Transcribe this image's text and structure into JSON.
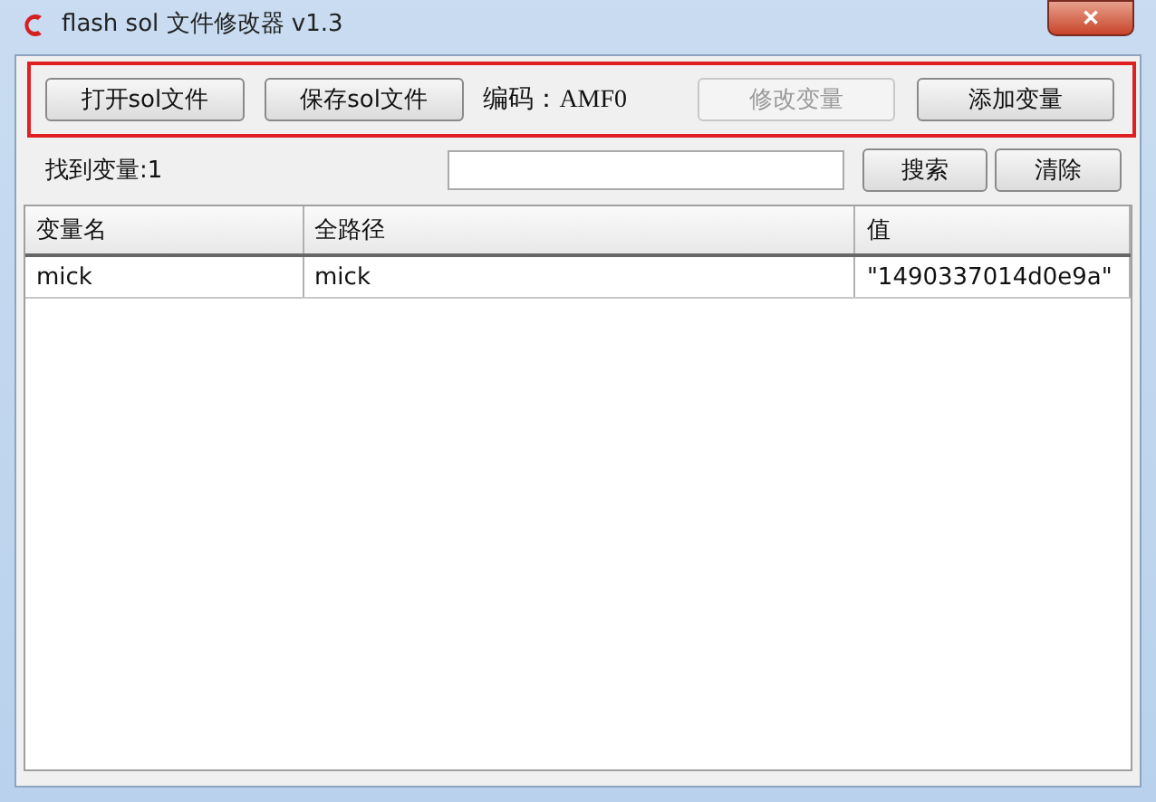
{
  "window": {
    "title": "flash sol 文件修改器 v1.3",
    "close": "✕"
  },
  "toolbar": {
    "buttons": [
      {
        "label": "打开sol文件",
        "disabled": false
      },
      {
        "label": "保存sol文件",
        "disabled": false
      }
    ],
    "encoding_label": "编码：AMF0",
    "actions": [
      {
        "label": "修改变量",
        "disabled": true
      },
      {
        "label": "添加变量",
        "disabled": false
      }
    ]
  },
  "search": {
    "found_label": "找到变量:1",
    "search_button": "搜索",
    "clear_button": "清除"
  },
  "table": {
    "columns": [
      "变量名",
      "全路径",
      "值"
    ],
    "rows": [
      [
        "mick",
        "mick",
        "\"1490337014d0e9a\""
      ]
    ]
  }
}
